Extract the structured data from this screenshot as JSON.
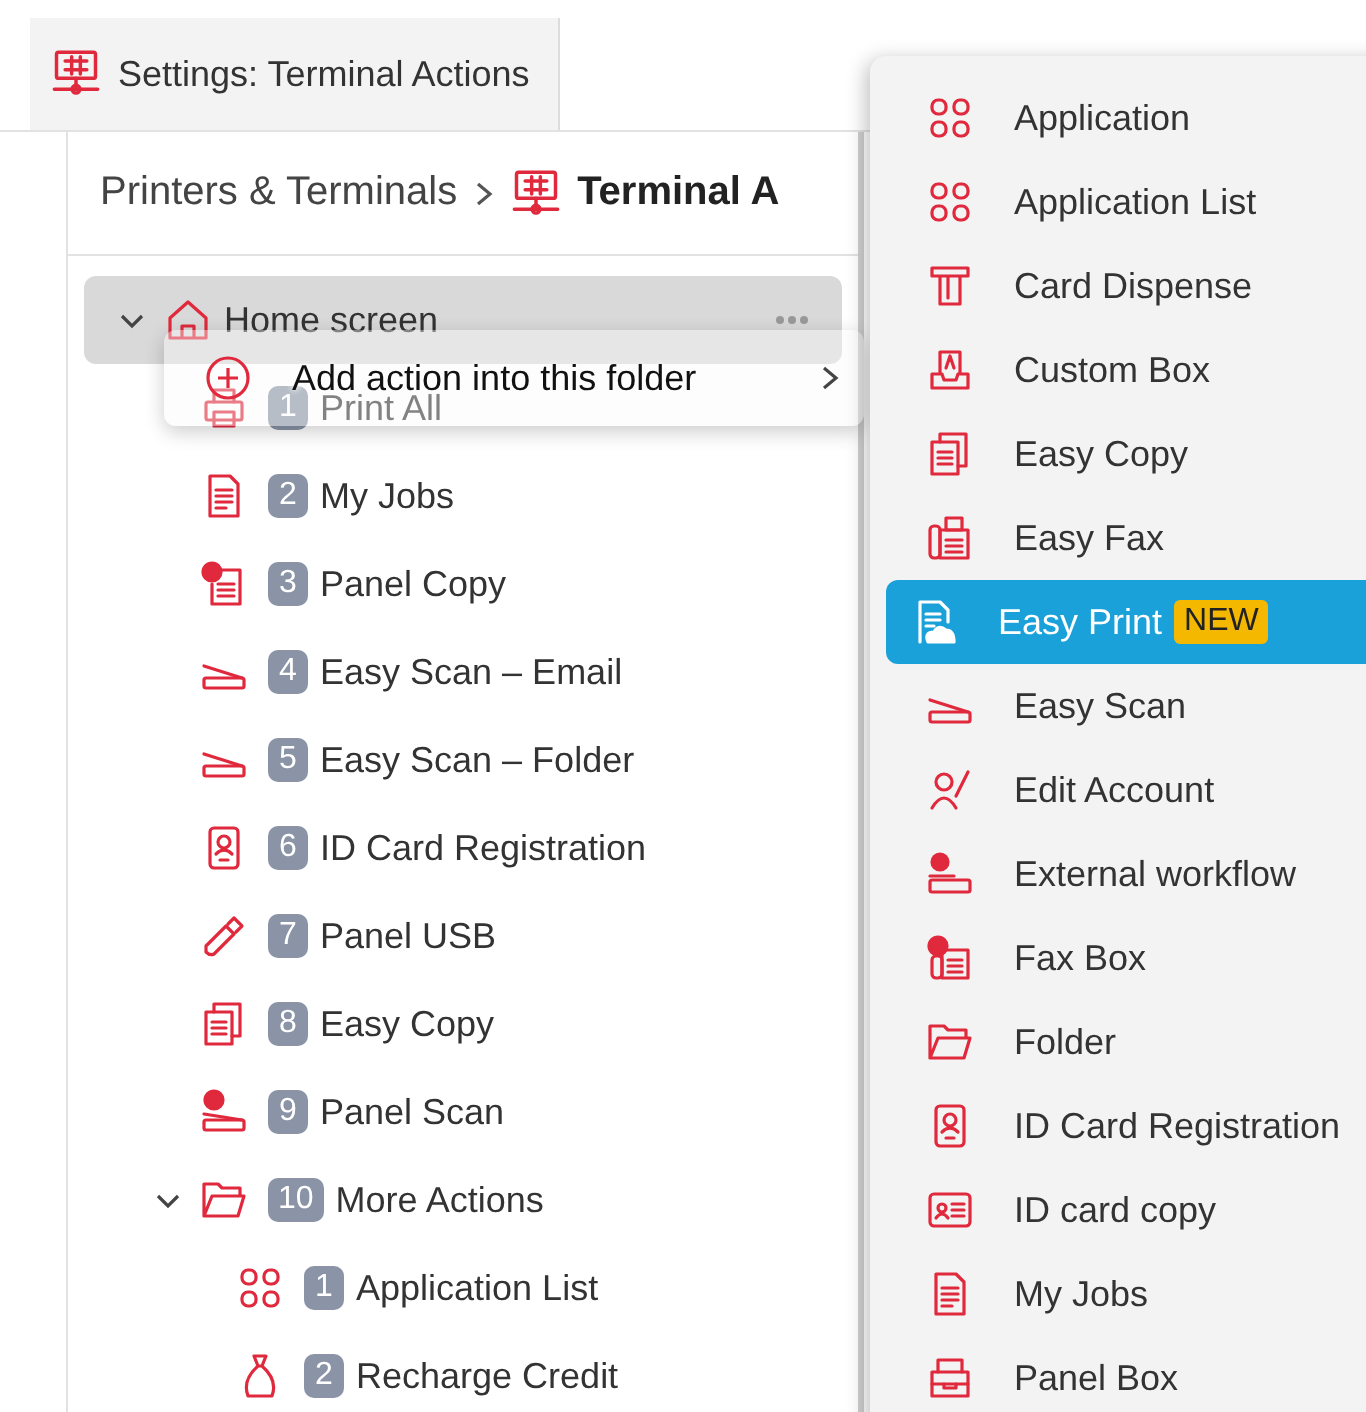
{
  "tab": {
    "label": "Settings: Terminal Actions",
    "kind": "terminal"
  },
  "breadcrumb": [
    {
      "label": "Printers & Terminals",
      "kind": "link"
    },
    {
      "label": "Terminal A",
      "kind": "current"
    }
  ],
  "tree": [
    {
      "label": "Home screen",
      "kind": "home",
      "expanded": true,
      "selected": true,
      "children": [
        {
          "badge": "1",
          "label": "Print All",
          "kind": "printer",
          "selected": false
        },
        {
          "badge": "2",
          "label": "My Jobs",
          "kind": "document",
          "selected": false
        },
        {
          "badge": "3",
          "label": "Panel Copy",
          "kind": "document-chat",
          "selected": false
        },
        {
          "badge": "4",
          "label": "Easy Scan – Email",
          "kind": "scanner",
          "selected": false
        },
        {
          "badge": "5",
          "label": "Easy Scan – Folder",
          "kind": "scanner",
          "selected": false
        },
        {
          "badge": "6",
          "label": "ID Card Registration",
          "kind": "id-card",
          "selected": false
        },
        {
          "badge": "7",
          "label": "Panel USB",
          "kind": "usb",
          "selected": false
        },
        {
          "badge": "8",
          "label": "Easy Copy",
          "kind": "copy",
          "selected": false
        },
        {
          "badge": "9",
          "label": "Panel Scan",
          "kind": "scanner-chat",
          "selected": false
        },
        {
          "badge": "10",
          "label": "More Actions",
          "kind": "folder",
          "expanded": true,
          "selected": false,
          "children": [
            {
              "badge": "1",
              "label": "Application List",
              "kind": "apps",
              "selected": false
            },
            {
              "badge": "2",
              "label": "Recharge Credit",
              "kind": "bag",
              "selected": false
            }
          ]
        }
      ]
    }
  ],
  "context_menu": {
    "label": "Add action into this folder"
  },
  "submenu": [
    {
      "label": "Application",
      "kind": "apps",
      "selected": false
    },
    {
      "label": "Application List",
      "kind": "apps",
      "selected": false
    },
    {
      "label": "Card Dispense",
      "kind": "dispense",
      "selected": false
    },
    {
      "label": "Custom Box",
      "kind": "custom-box",
      "selected": false
    },
    {
      "label": "Easy Copy",
      "kind": "copy",
      "selected": false
    },
    {
      "label": "Easy Fax",
      "kind": "fax",
      "selected": false
    },
    {
      "label": "Easy Print",
      "kind": "cloud-doc",
      "selected": true,
      "badge": "NEW"
    },
    {
      "label": "Easy Scan",
      "kind": "scanner",
      "selected": false
    },
    {
      "label": "Edit Account",
      "kind": "edit-account",
      "selected": false
    },
    {
      "label": "External workflow",
      "kind": "workflow",
      "selected": false
    },
    {
      "label": "Fax Box",
      "kind": "fax-box",
      "selected": false
    },
    {
      "label": "Folder",
      "kind": "folder",
      "selected": false
    },
    {
      "label": "ID Card Registration",
      "kind": "id-card",
      "selected": false
    },
    {
      "label": "ID card copy",
      "kind": "id-copy",
      "selected": false
    },
    {
      "label": "My Jobs",
      "kind": "document",
      "selected": false
    },
    {
      "label": "Panel Box",
      "kind": "panel-box",
      "selected": false
    }
  ]
}
